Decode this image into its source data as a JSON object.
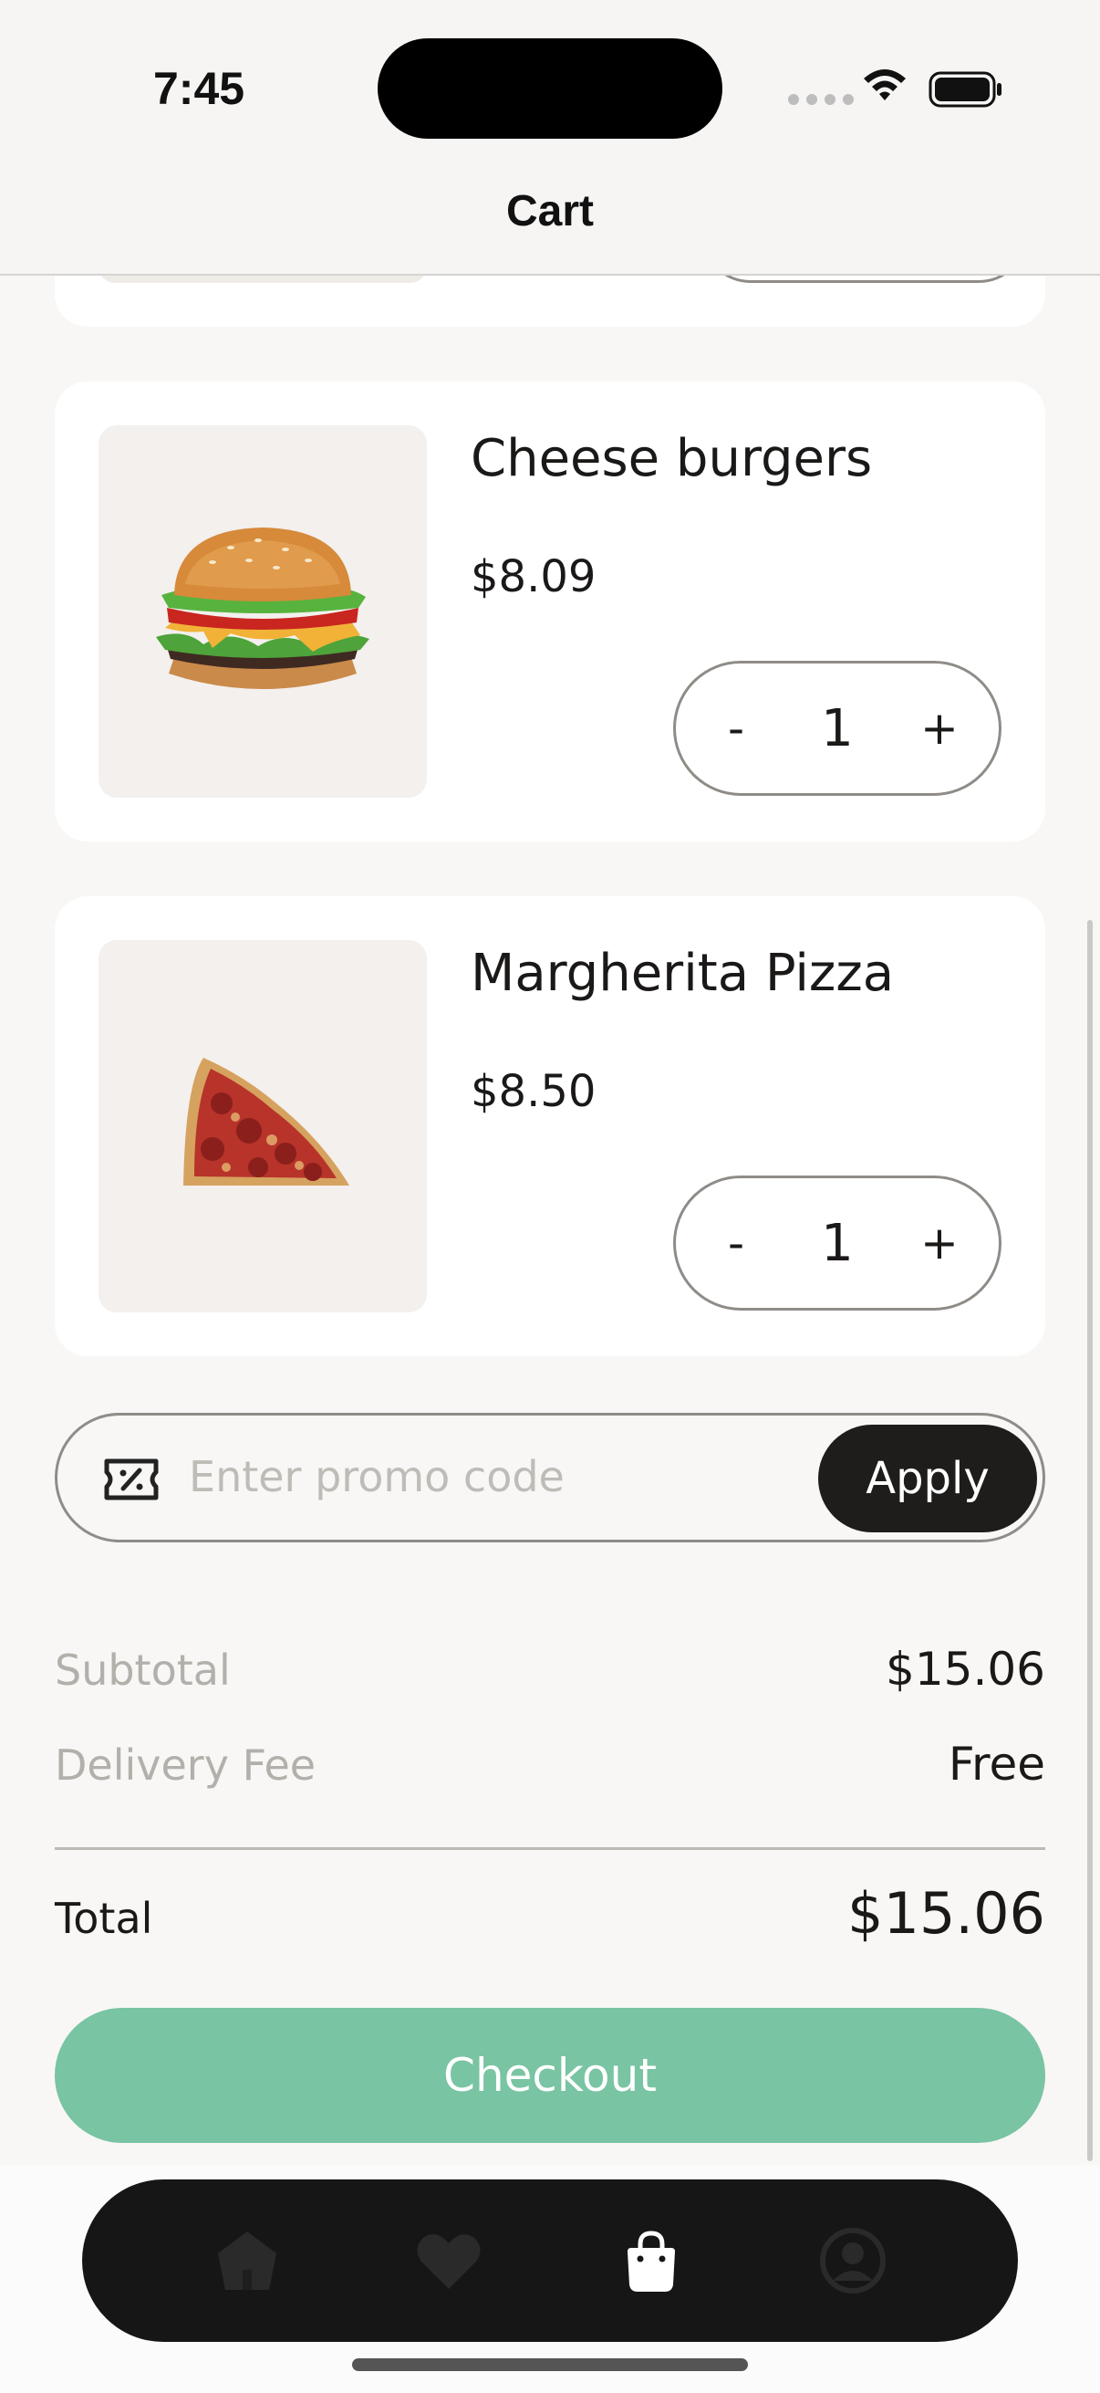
{
  "status_bar": {
    "time": "7:45"
  },
  "header": {
    "title": "Cart"
  },
  "cart": {
    "items": [
      {
        "name": "Cheese burgers",
        "price": "$8.09",
        "quantity": "1",
        "image": "cheeseburger"
      },
      {
        "name": "Margherita Pizza",
        "price": "$8.50",
        "quantity": "1",
        "image": "pizza-slice"
      }
    ],
    "stepper": {
      "decrement": "-",
      "increment": "+"
    }
  },
  "promo": {
    "placeholder": "Enter promo code",
    "apply_label": "Apply",
    "icon": "ticket-percent-icon"
  },
  "summary": {
    "subtotal_label": "Subtotal",
    "subtotal_value": "$15.06",
    "delivery_label": "Delivery Fee",
    "delivery_value": "Free",
    "total_label": "Total",
    "total_value": "$15.06"
  },
  "checkout_label": "Checkout",
  "tab_bar": {
    "items": [
      {
        "icon": "home-icon",
        "active": false
      },
      {
        "icon": "heart-icon",
        "active": false
      },
      {
        "icon": "shopping-bag-icon",
        "active": true
      },
      {
        "icon": "profile-icon",
        "active": false
      }
    ]
  },
  "colors": {
    "accent": "#79c4a2",
    "dark": "#1f1d1b",
    "background": "#f8f7f5"
  }
}
